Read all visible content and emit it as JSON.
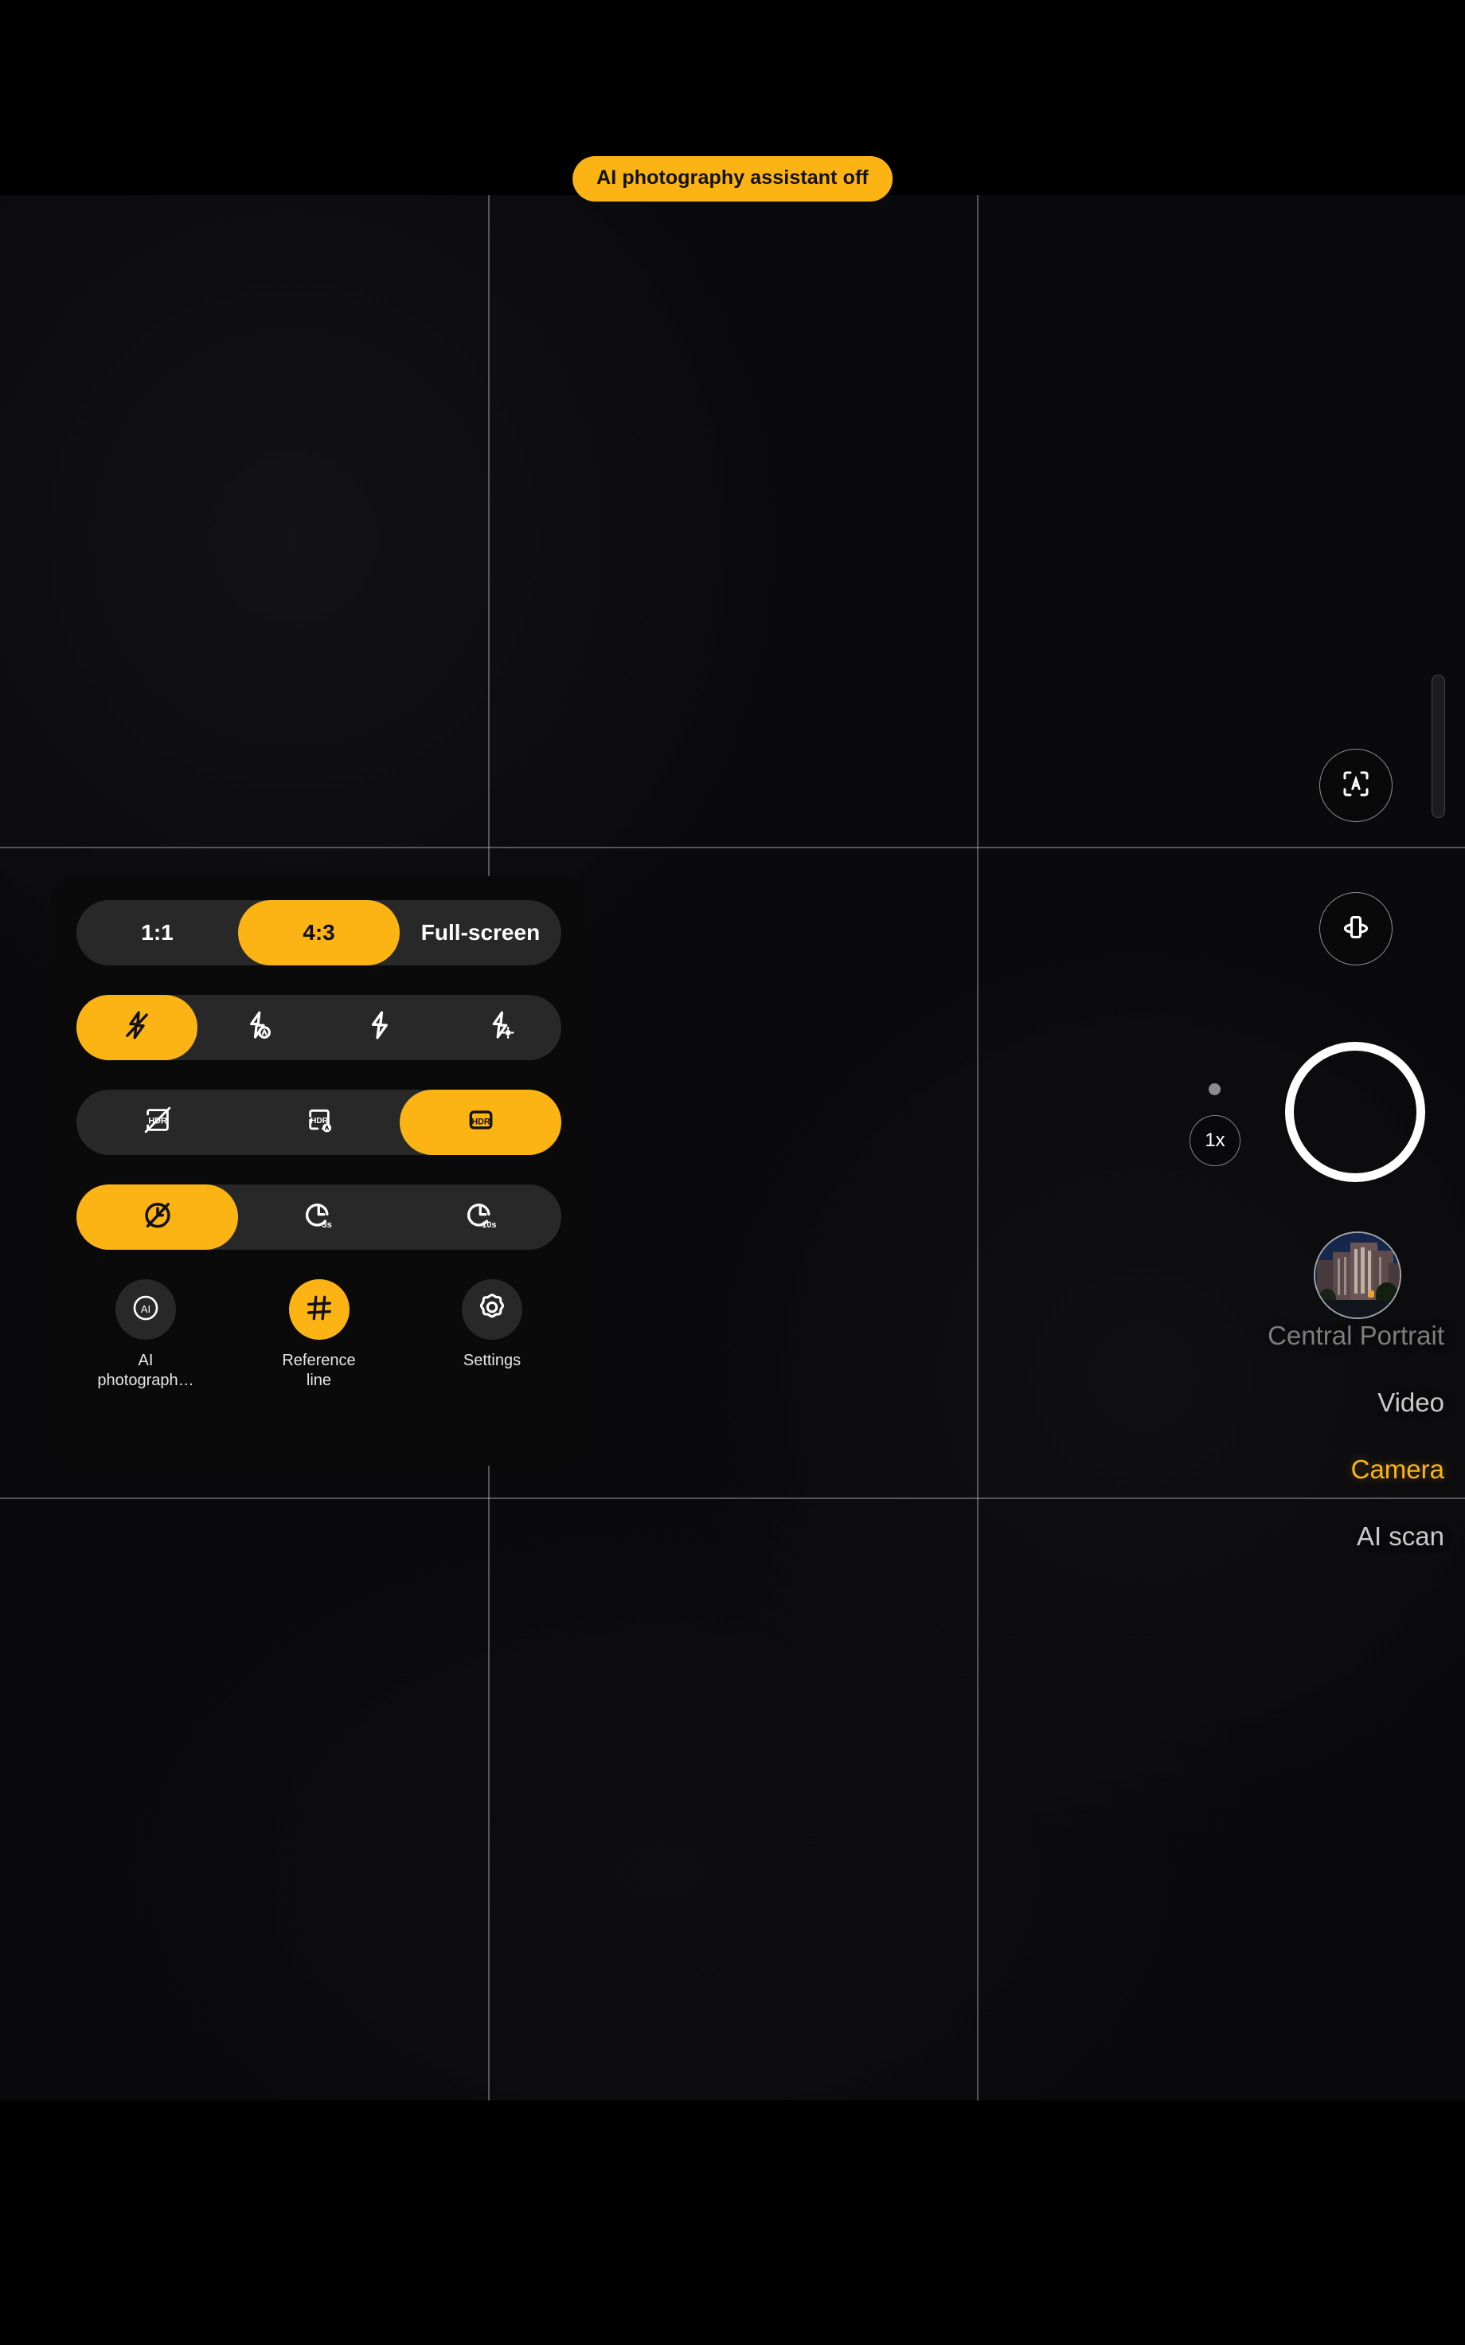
{
  "theme": {
    "accent": "#FCB415",
    "panel_bg": "#0a0a0a",
    "track_bg": "#282828",
    "text": "#ffffff"
  },
  "toast": {
    "message": "AI photography assistant off"
  },
  "viewfinder": {
    "grid_enabled": true,
    "grid_name": "rule-of-thirds"
  },
  "right_rail": {
    "auto_scene_button": {
      "icon": "auto-scene-icon",
      "label": "A"
    },
    "flip_camera_button": {
      "icon": "flip-camera-icon"
    },
    "scrollbar": {
      "name": "zoom-slider"
    },
    "shutter": {
      "name": "shutter-button"
    },
    "zoom": {
      "value": "1x"
    }
  },
  "modes": {
    "items": [
      {
        "label": "Central Portrait",
        "state": "dim"
      },
      {
        "label": "Video",
        "state": "normal"
      },
      {
        "label": "Camera",
        "state": "active"
      },
      {
        "label": "AI scan",
        "state": "normal"
      }
    ],
    "thumbnail_alt": "last-photo-thumbnail"
  },
  "settings_panel": {
    "aspect_ratio": {
      "name": "aspect-ratio-selector",
      "options": [
        {
          "label": "1:1",
          "selected": false
        },
        {
          "label": "4:3",
          "selected": true
        },
        {
          "label": "Full-screen",
          "selected": false
        }
      ]
    },
    "flash": {
      "name": "flash-selector",
      "options": [
        {
          "icon": "flash-off-icon",
          "selected": true
        },
        {
          "icon": "flash-auto-icon",
          "selected": false
        },
        {
          "icon": "flash-on-icon",
          "selected": false
        },
        {
          "icon": "flash-fill-light-icon",
          "selected": false
        }
      ]
    },
    "hdr": {
      "name": "hdr-selector",
      "options": [
        {
          "icon": "hdr-off-icon",
          "selected": false
        },
        {
          "icon": "hdr-auto-icon",
          "selected": false
        },
        {
          "icon": "hdr-on-icon",
          "selected": true
        }
      ]
    },
    "timer": {
      "name": "timer-selector",
      "options": [
        {
          "icon": "timer-off-icon",
          "label": "",
          "selected": true
        },
        {
          "icon": "timer-3s-icon",
          "label": "3s",
          "selected": false
        },
        {
          "icon": "timer-10s-icon",
          "label": "10s",
          "selected": false
        }
      ]
    },
    "tiles": [
      {
        "icon": "ai-photography-icon",
        "label": "AI\nphotograph…",
        "active": false
      },
      {
        "icon": "reference-line-icon",
        "label": "Reference\nline",
        "active": true
      },
      {
        "icon": "settings-gear-icon",
        "label": "Settings",
        "active": false
      }
    ]
  }
}
